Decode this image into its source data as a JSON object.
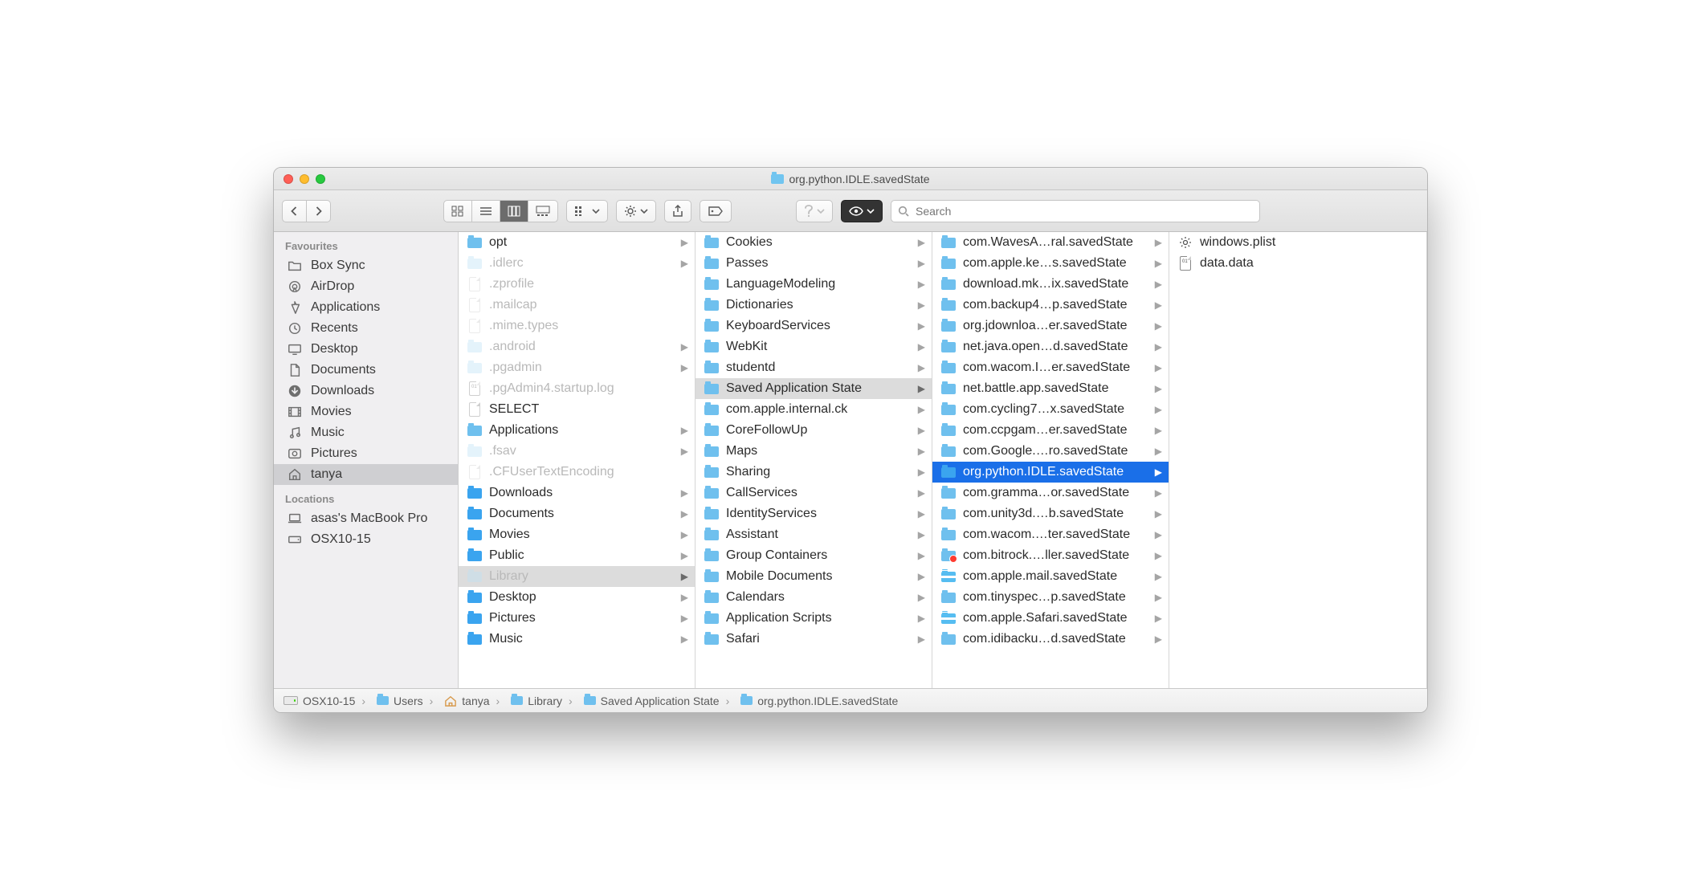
{
  "window": {
    "title": "org.python.IDLE.savedState"
  },
  "search": {
    "placeholder": "Search"
  },
  "sidebar": {
    "sections": [
      {
        "heading": "Favourites",
        "items": [
          {
            "icon": "folder-outline",
            "label": "Box Sync"
          },
          {
            "icon": "airdrop",
            "label": "AirDrop"
          },
          {
            "icon": "apps",
            "label": "Applications"
          },
          {
            "icon": "recents",
            "label": "Recents"
          },
          {
            "icon": "desktop",
            "label": "Desktop"
          },
          {
            "icon": "documents",
            "label": "Documents"
          },
          {
            "icon": "downloads",
            "label": "Downloads"
          },
          {
            "icon": "movies",
            "label": "Movies"
          },
          {
            "icon": "music",
            "label": "Music"
          },
          {
            "icon": "pictures",
            "label": "Pictures"
          },
          {
            "icon": "home",
            "label": "tanya",
            "selected": true
          }
        ]
      },
      {
        "heading": "Locations",
        "items": [
          {
            "icon": "laptop",
            "label": "asas's MacBook Pro"
          },
          {
            "icon": "hdd",
            "label": "OSX10-15"
          }
        ]
      }
    ]
  },
  "columns": {
    "c1": [
      {
        "label": "opt",
        "type": "folder-blue",
        "arrow": true
      },
      {
        "label": ".idlerc",
        "type": "folder-lblue",
        "arrow": true,
        "dim": true
      },
      {
        "label": ".zprofile",
        "type": "file",
        "dim": true
      },
      {
        "label": ".mailcap",
        "type": "file",
        "dim": true
      },
      {
        "label": ".mime.types",
        "type": "file",
        "dim": true
      },
      {
        "label": ".android",
        "type": "folder-lblue",
        "arrow": true,
        "dim": true
      },
      {
        "label": ".pgadmin",
        "type": "folder-lblue",
        "arrow": true,
        "dim": true
      },
      {
        "label": ".pgAdmin4.startup.log",
        "type": "file-bin",
        "dim": true
      },
      {
        "label": "SELECT",
        "type": "file"
      },
      {
        "label": "Applications",
        "type": "folder-blue",
        "arrow": true
      },
      {
        "label": ".fsav",
        "type": "folder-lblue",
        "arrow": true,
        "dim": true
      },
      {
        "label": ".CFUserTextEncoding",
        "type": "file",
        "dim": true
      },
      {
        "label": "Downloads",
        "type": "folder-bright",
        "arrow": true
      },
      {
        "label": "Documents",
        "type": "folder-bright",
        "arrow": true
      },
      {
        "label": "Movies",
        "type": "folder-bright",
        "arrow": true
      },
      {
        "label": "Public",
        "type": "folder-bright",
        "arrow": true
      },
      {
        "label": "Library",
        "type": "folder-lblue",
        "arrow": true,
        "dim": true,
        "pathsel": true
      },
      {
        "label": "Desktop",
        "type": "folder-bright",
        "arrow": true
      },
      {
        "label": "Pictures",
        "type": "folder-bright",
        "arrow": true
      },
      {
        "label": "Music",
        "type": "folder-bright",
        "arrow": true
      }
    ],
    "c2": [
      {
        "label": "Cookies",
        "type": "folder-blue",
        "arrow": true
      },
      {
        "label": "Passes",
        "type": "folder-blue",
        "arrow": true
      },
      {
        "label": "LanguageModeling",
        "type": "folder-blue",
        "arrow": true
      },
      {
        "label": "Dictionaries",
        "type": "folder-blue",
        "arrow": true
      },
      {
        "label": "KeyboardServices",
        "type": "folder-blue",
        "arrow": true
      },
      {
        "label": "WebKit",
        "type": "folder-blue",
        "arrow": true
      },
      {
        "label": "studentd",
        "type": "folder-blue",
        "arrow": true
      },
      {
        "label": "Saved Application State",
        "type": "folder-blue",
        "arrow": true,
        "pathsel": true
      },
      {
        "label": "com.apple.internal.ck",
        "type": "folder-blue",
        "arrow": true
      },
      {
        "label": "CoreFollowUp",
        "type": "folder-blue",
        "arrow": true
      },
      {
        "label": "Maps",
        "type": "folder-blue",
        "arrow": true
      },
      {
        "label": "Sharing",
        "type": "folder-blue",
        "arrow": true
      },
      {
        "label": "CallServices",
        "type": "folder-blue",
        "arrow": true
      },
      {
        "label": "IdentityServices",
        "type": "folder-blue",
        "arrow": true
      },
      {
        "label": "Assistant",
        "type": "folder-blue",
        "arrow": true
      },
      {
        "label": "Group Containers",
        "type": "folder-blue",
        "arrow": true
      },
      {
        "label": "Mobile Documents",
        "type": "folder-blue",
        "arrow": true
      },
      {
        "label": "Calendars",
        "type": "folder-blue",
        "arrow": true
      },
      {
        "label": "Application Scripts",
        "type": "folder-blue",
        "arrow": true
      },
      {
        "label": "Safari",
        "type": "folder-blue",
        "arrow": true
      }
    ],
    "c3": [
      {
        "label": "com.WavesA…ral.savedState",
        "type": "folder-blue",
        "arrow": true
      },
      {
        "label": "com.apple.ke…s.savedState",
        "type": "folder-blue",
        "arrow": true
      },
      {
        "label": "download.mk…ix.savedState",
        "type": "folder-blue",
        "arrow": true
      },
      {
        "label": "com.backup4…p.savedState",
        "type": "folder-blue",
        "arrow": true
      },
      {
        "label": "org.jdownloa…er.savedState",
        "type": "folder-blue",
        "arrow": true
      },
      {
        "label": "net.java.open…d.savedState",
        "type": "folder-blue",
        "arrow": true
      },
      {
        "label": "com.wacom.I…er.savedState",
        "type": "folder-blue",
        "arrow": true
      },
      {
        "label": "net.battle.app.savedState",
        "type": "folder-blue",
        "arrow": true
      },
      {
        "label": "com.cycling7…x.savedState",
        "type": "folder-blue",
        "arrow": true
      },
      {
        "label": "com.ccpgam…er.savedState",
        "type": "folder-blue",
        "arrow": true
      },
      {
        "label": "com.Google.…ro.savedState",
        "type": "folder-blue",
        "arrow": true
      },
      {
        "label": "org.python.IDLE.savedState",
        "type": "folder-bright",
        "arrow": true,
        "activesel": true
      },
      {
        "label": "com.gramma…or.savedState",
        "type": "folder-blue",
        "arrow": true
      },
      {
        "label": "com.unity3d.…b.savedState",
        "type": "folder-blue",
        "arrow": true
      },
      {
        "label": "com.wacom.…ter.savedState",
        "type": "folder-blue",
        "arrow": true
      },
      {
        "label": "com.bitrock.…ller.savedState",
        "type": "folder-reddot",
        "arrow": true
      },
      {
        "label": "com.apple.mail.savedState",
        "type": "folder-striped",
        "arrow": true
      },
      {
        "label": "com.tinyspec…p.savedState",
        "type": "folder-blue",
        "arrow": true
      },
      {
        "label": "com.apple.Safari.savedState",
        "type": "folder-striped",
        "arrow": true
      },
      {
        "label": "com.idibacku…d.savedState",
        "type": "folder-blue",
        "arrow": true
      }
    ],
    "c4": [
      {
        "label": "windows.plist",
        "type": "file-gear"
      },
      {
        "label": "data.data",
        "type": "file-bin"
      }
    ]
  },
  "path": [
    {
      "icon": "hdd",
      "label": "OSX10-15"
    },
    {
      "icon": "folder",
      "label": "Users"
    },
    {
      "icon": "home",
      "label": "tanya"
    },
    {
      "icon": "folder",
      "label": "Library"
    },
    {
      "icon": "folder",
      "label": "Saved Application State"
    },
    {
      "icon": "folder",
      "label": "org.python.IDLE.savedState"
    }
  ]
}
